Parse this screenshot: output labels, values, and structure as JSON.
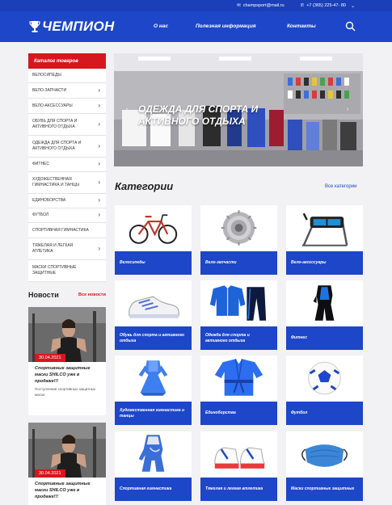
{
  "topbar": {
    "email": "champsport@mail.ru",
    "phone": "+7 (365) 225-47- 80"
  },
  "header": {
    "logo_text": "ЧЕМПИОН",
    "nav": [
      "О нас",
      "Полезная информация",
      "Контакты"
    ]
  },
  "sidebar": {
    "catalog_title": "Каталог товаров",
    "items": [
      {
        "label": "ВЕЛОСИПЕДЫ",
        "has_arrow": false
      },
      {
        "label": "ВЕЛО-ЗАПЧАСТИ",
        "has_arrow": true
      },
      {
        "label": "ВЕЛО-АКСЕССУАРЫ",
        "has_arrow": true
      },
      {
        "label": "ОБУВЬ ДЛЯ СПОРТА И АКТИВНОГО ОТДЫХА",
        "has_arrow": true
      },
      {
        "label": "ОДЕЖДА ДЛЯ СПОРТА И АКТИВНОГО ОТДЫХА",
        "has_arrow": true
      },
      {
        "label": "ФИТНЕС",
        "has_arrow": true
      },
      {
        "label": "ХУДОЖЕСТВЕННАЯ ГИМНАСТИКА И ТАНЦЫ",
        "has_arrow": true
      },
      {
        "label": "ЕДИНОБОРСТВА",
        "has_arrow": true
      },
      {
        "label": "ФУТБОЛ",
        "has_arrow": true
      },
      {
        "label": "СПОРТИВНАЯ ГИМНАСТИКА",
        "has_arrow": false
      },
      {
        "label": "ТЯЖЕЛАЯ И ЛЕГКАЯ АТЛЕТИКА",
        "has_arrow": true
      },
      {
        "label": "МАСКИ СПОРТИВНЫЕ ЗАЩИТНЫЕ",
        "has_arrow": false
      }
    ]
  },
  "news": {
    "title": "Новости",
    "all_link": "Все новости",
    "items": [
      {
        "date": "30.04.2021",
        "title": "Спортивные защитные маски SHILCO уже в продаже!!!",
        "text": "Поступление спортивных защитных масок"
      },
      {
        "date": "30.04.2021",
        "title": "Спортивные защитные маски SHILCO уже в продаже!!!",
        "text": ""
      }
    ]
  },
  "banner": {
    "title": "ОДЕЖДА ДЛЯ СПОРТА И АКТИВНОГО ОТДЫХА"
  },
  "categories": {
    "title": "Категории",
    "all_link": "Все категории",
    "items": [
      {
        "label": "Велосипеды",
        "icon": "bicycle-icon"
      },
      {
        "label": "Вело-запчасти",
        "icon": "gear-cassette-icon"
      },
      {
        "label": "Вело-аксессуары",
        "icon": "bike-bag-icon"
      },
      {
        "label": "Обувь для спорта и активного отдыха",
        "icon": "sneaker-icon"
      },
      {
        "label": "Одежда для спорта и активного отдыха",
        "icon": "tracksuit-icon"
      },
      {
        "label": "Фитнес",
        "icon": "fitness-suit-icon"
      },
      {
        "label": "Художественная гимнастика и танцы",
        "icon": "dance-dress-icon"
      },
      {
        "label": "Единоборства",
        "icon": "kimono-icon"
      },
      {
        "label": "Футбол",
        "icon": "football-icon"
      },
      {
        "label": "Спортивная гимнастика",
        "icon": "leotard-icon"
      },
      {
        "label": "Тяжелая и легкая атлетика",
        "icon": "weightlifting-shoes-icon"
      },
      {
        "label": "Маски спортивные защитные",
        "icon": "face-mask-icon"
      }
    ]
  },
  "colors": {
    "brand_blue": "#1d46c8",
    "accent_red": "#d6171e"
  }
}
